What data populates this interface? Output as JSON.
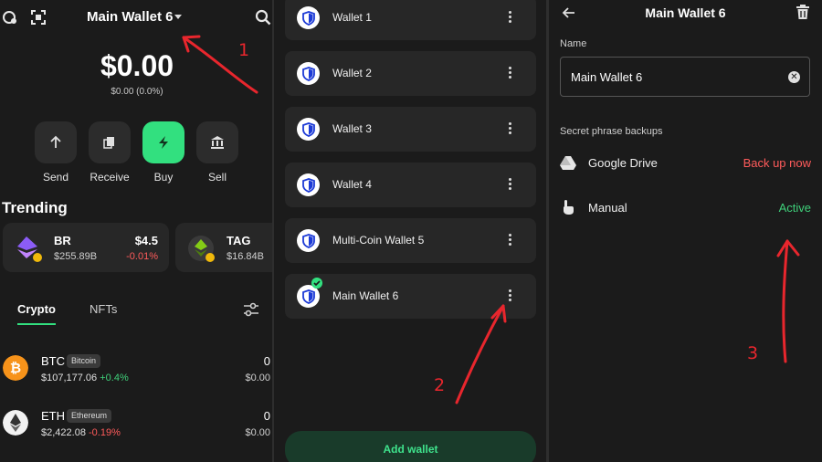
{
  "panel1": {
    "wallet_title": "Main Wallet 6",
    "balance": "$0.00",
    "balance_sub": "$0.00 (0.0%)",
    "actions": [
      {
        "label": "Send",
        "icon": "arrow-up-icon"
      },
      {
        "label": "Receive",
        "icon": "receive-icon"
      },
      {
        "label": "Buy",
        "icon": "lightning-icon"
      },
      {
        "label": "Sell",
        "icon": "bank-icon"
      }
    ],
    "trending_title": "Trending",
    "trending": [
      {
        "symbol": "BR",
        "cap": "$255.89B",
        "price": "$4.5",
        "change": "-0.01%"
      },
      {
        "symbol": "TAG",
        "cap": "$16.84B"
      }
    ],
    "tabs": [
      {
        "label": "Crypto",
        "active": true
      },
      {
        "label": "NFTs",
        "active": false
      }
    ],
    "coins": [
      {
        "symbol": "BTC",
        "name": "Bitcoin",
        "price": "$107,177.06",
        "change": "+0.4%",
        "change_color": "#3fd07a",
        "balance": "0",
        "value": "$0.00"
      },
      {
        "symbol": "ETH",
        "name": "Ethereum",
        "price": "$2,422.08",
        "change": "-0.19%",
        "change_color": "#ff5b5b",
        "balance": "0",
        "value": "$0.00"
      }
    ]
  },
  "panel2": {
    "wallets": [
      {
        "name": "Wallet 1"
      },
      {
        "name": "Wallet 2"
      },
      {
        "name": "Wallet 3"
      },
      {
        "name": "Wallet 4"
      },
      {
        "name": "Multi-Coin Wallet 5"
      },
      {
        "name": "Main Wallet 6",
        "selected": true
      }
    ],
    "add_wallet_label": "Add wallet"
  },
  "panel3": {
    "title": "Main Wallet 6",
    "name_label": "Name",
    "name_value": "Main Wallet 6",
    "backups_label": "Secret phrase backups",
    "backups": [
      {
        "label": "Google Drive",
        "status": "Back up now",
        "status_color": "#ff5b5b",
        "icon": "google-drive-icon"
      },
      {
        "label": "Manual",
        "status": "Active",
        "status_color": "#3fd07a",
        "icon": "hand-pointer-icon"
      }
    ]
  },
  "annotations": [
    "1",
    "2",
    "3"
  ],
  "colors": {
    "background": "#1b1b1b",
    "card": "#272727",
    "accent": "#32e07f",
    "negative": "#ff5b5b",
    "annotation": "#e8262d"
  }
}
